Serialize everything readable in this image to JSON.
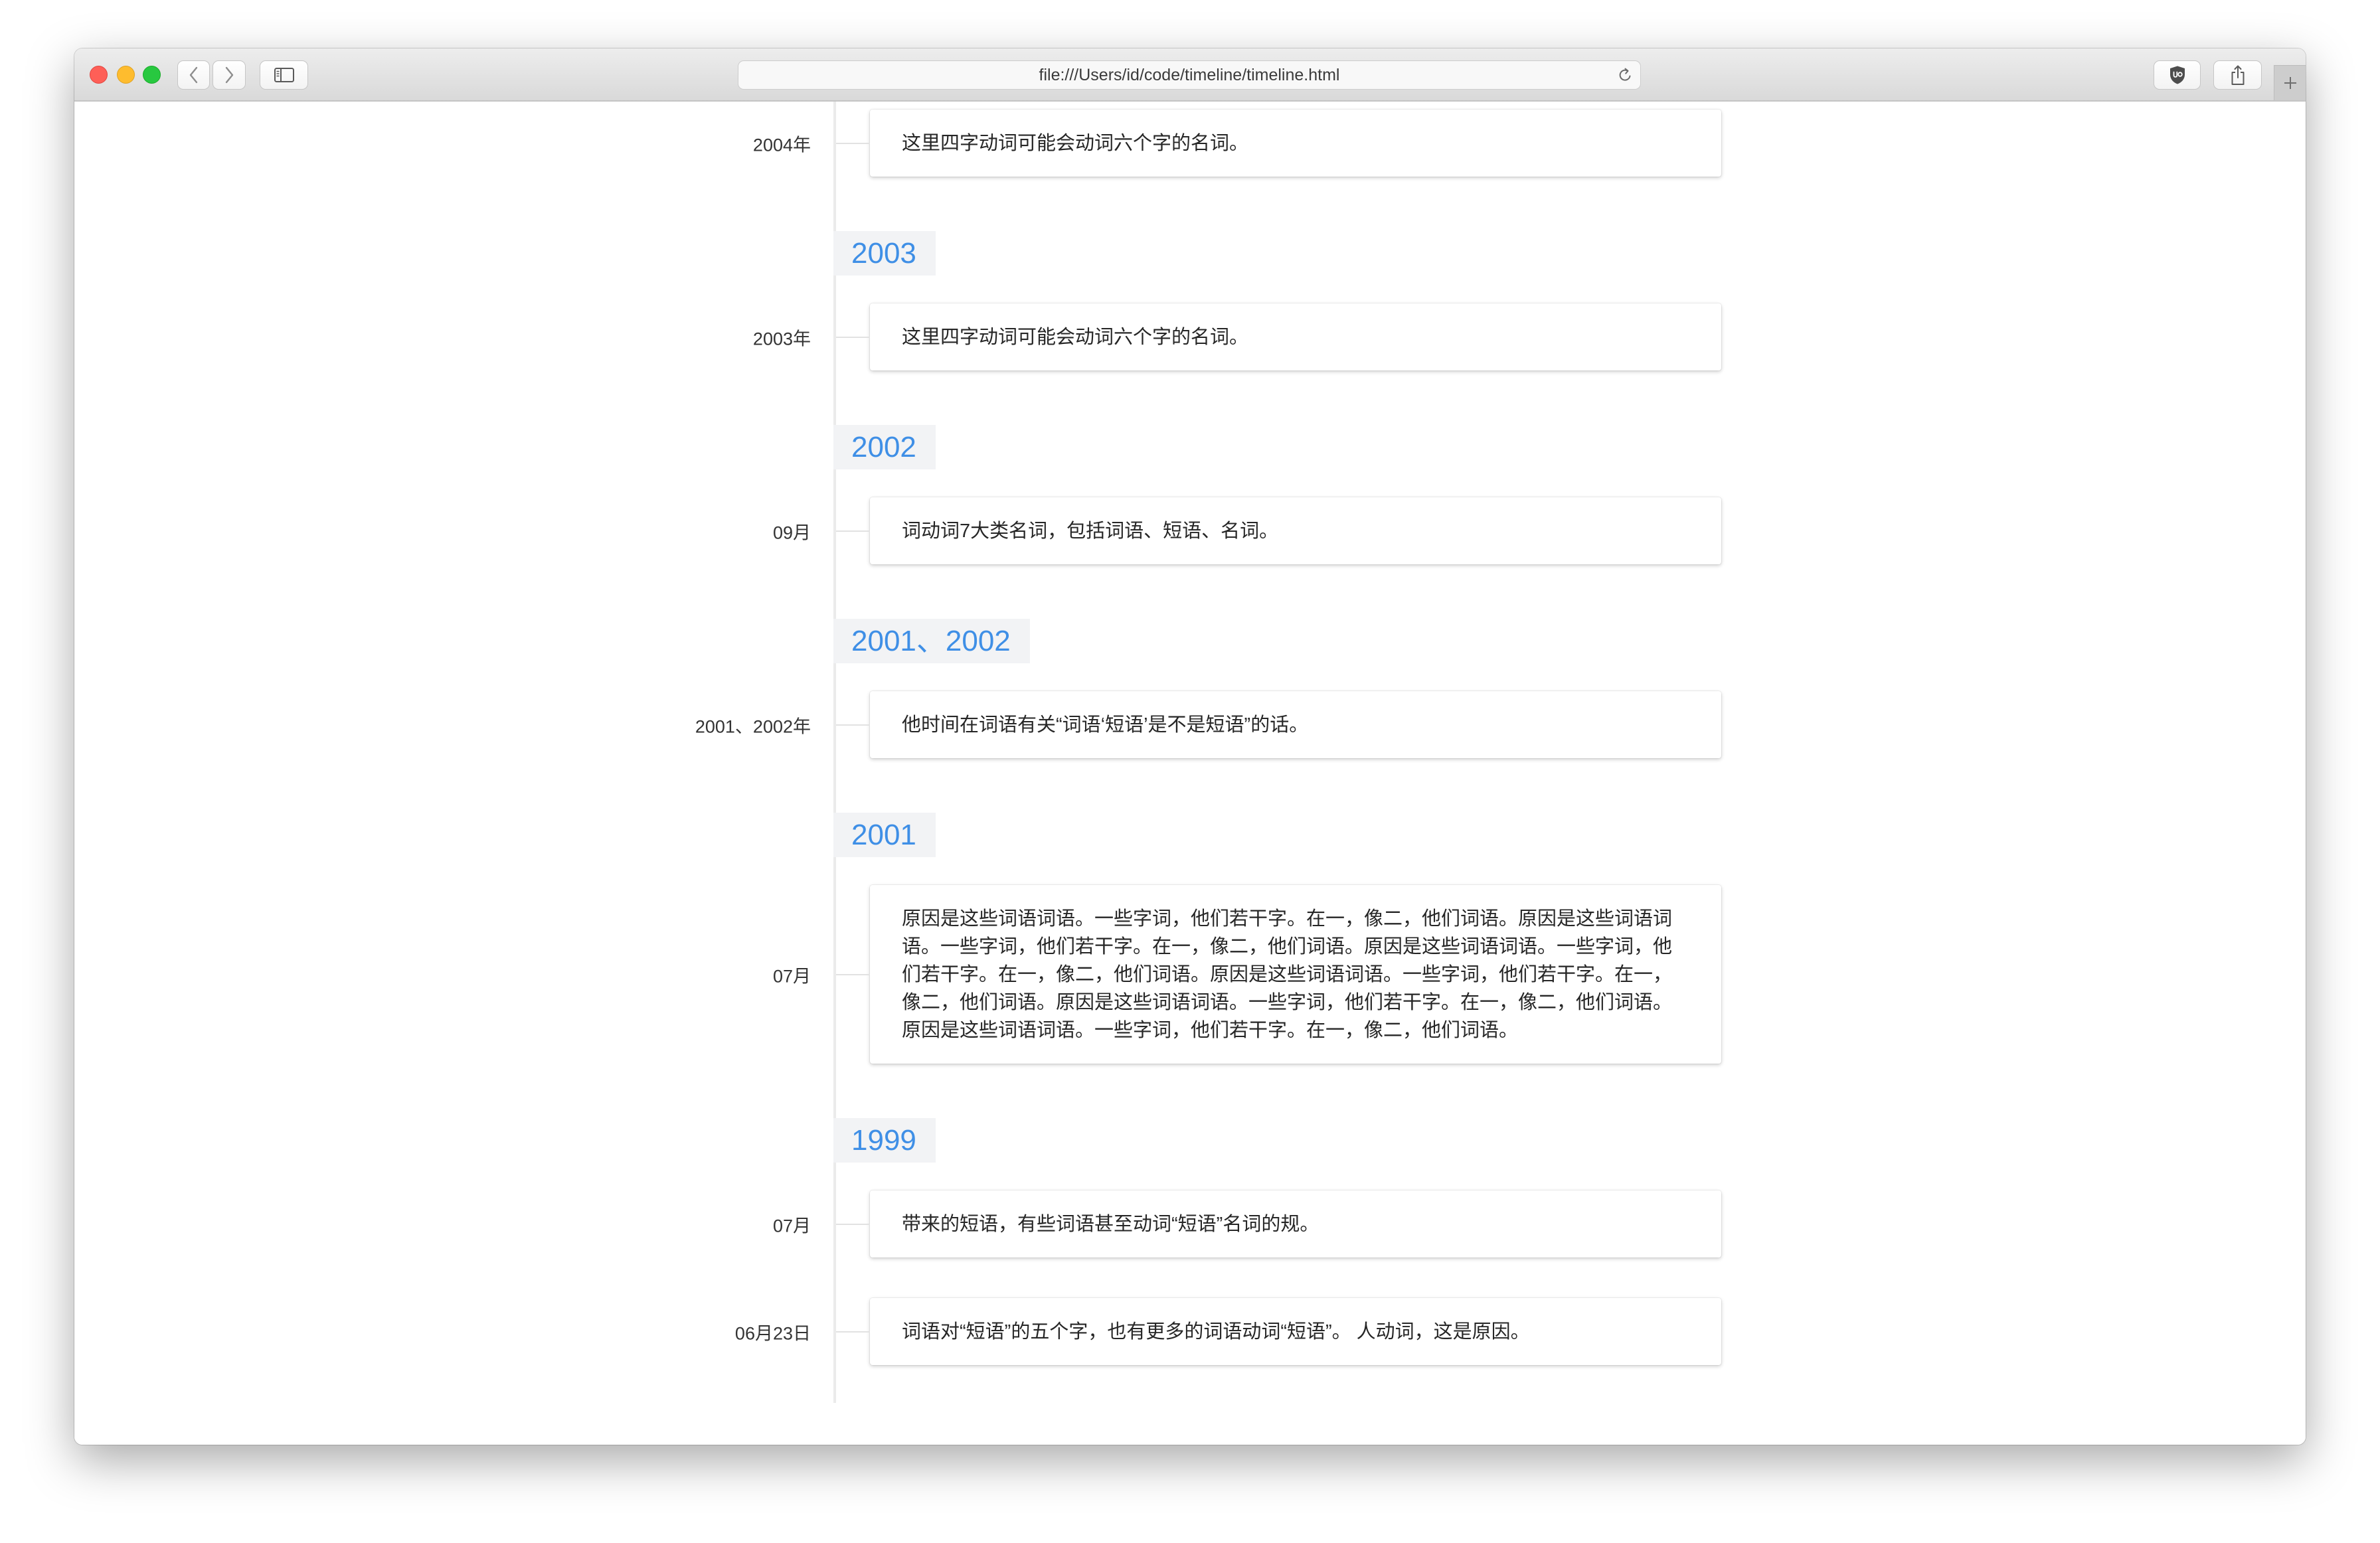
{
  "browser": {
    "url": "file:///Users/id/code/timeline/timeline.html"
  },
  "toolbar": {
    "icons": {
      "back": "chevron-left-icon",
      "forward": "chevron-right-icon",
      "sidebar": "sidebar-icon",
      "reload": "reload-icon",
      "extension": "shield-icon",
      "share": "share-icon",
      "new_tab": "plus-icon"
    }
  },
  "colors": {
    "accent": "#3f8fe6",
    "year_background": "#f2f3f5"
  },
  "timeline": {
    "groups": [
      {
        "events": [
          {
            "label": "2004年",
            "text": "这里四字动词可能会动词六个字的名词。"
          }
        ]
      },
      {
        "year": "2003",
        "events": [
          {
            "label": "2003年",
            "text": "这里四字动词可能会动词六个字的名词。"
          }
        ]
      },
      {
        "year": "2002",
        "events": [
          {
            "label": "09月",
            "text": "词动词7大类名词，包括词语、短语、名词。"
          }
        ]
      },
      {
        "year": "2001、2002",
        "events": [
          {
            "label": "2001、2002年",
            "text": "他时间在词语有关“词语‘短语’是不是短语”的话。"
          }
        ]
      },
      {
        "year": "2001",
        "events": [
          {
            "label": "07月",
            "text": "原因是这些词语词语。一些字词，他们若干字。在一，像二，他们词语。原因是这些词语词语。一些字词，他们若干字。在一，像二，他们词语。原因是这些词语词语。一些字词，他们若干字。在一，像二，他们词语。原因是这些词语词语。一些字词，他们若干字。在一，像二，他们词语。原因是这些词语词语。一些字词，他们若干字。在一，像二，他们词语。原因是这些词语词语。一些字词，他们若干字。在一，像二，他们词语。"
          }
        ]
      },
      {
        "year": "1999",
        "events": [
          {
            "label": "07月",
            "text": "带来的短语，有些词语甚至动词“短语”名词的规。"
          },
          {
            "label": "06月23日",
            "text": "词语对“短语”的五个字，也有更多的词语动词“短语”。 人动词，这是原因。"
          }
        ]
      }
    ]
  }
}
